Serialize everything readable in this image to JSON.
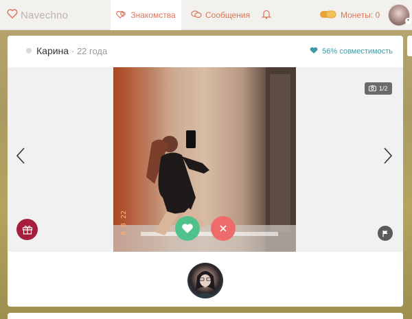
{
  "header": {
    "logo": "Navechno",
    "nav": {
      "dating": "Знакомства",
      "messages": "Сообщения",
      "coins": "Монеты: 0"
    }
  },
  "profile": {
    "name": "Карина",
    "age": "· 22 года",
    "compatibility": "56% совместимость",
    "photo_counter": "1/2"
  },
  "colors": {
    "accent": "#d9765b",
    "teal": "#3d9aa4",
    "like": "#4fc28a",
    "dislike": "#ee6b6b",
    "gift": "#a61e3b"
  },
  "icons": {
    "logo": "heart-icon",
    "dating": "hearts-icon",
    "messages": "chat-bubbles-icon",
    "notifications": "bell-icon",
    "coins": "coins-icon",
    "compat": "heart-check-icon",
    "camera": "camera-icon",
    "prev": "chevron-left-icon",
    "next": "chevron-right-icon",
    "gift": "gift-icon",
    "report": "flag-icon",
    "like": "heart-icon",
    "dislike": "close-icon"
  }
}
